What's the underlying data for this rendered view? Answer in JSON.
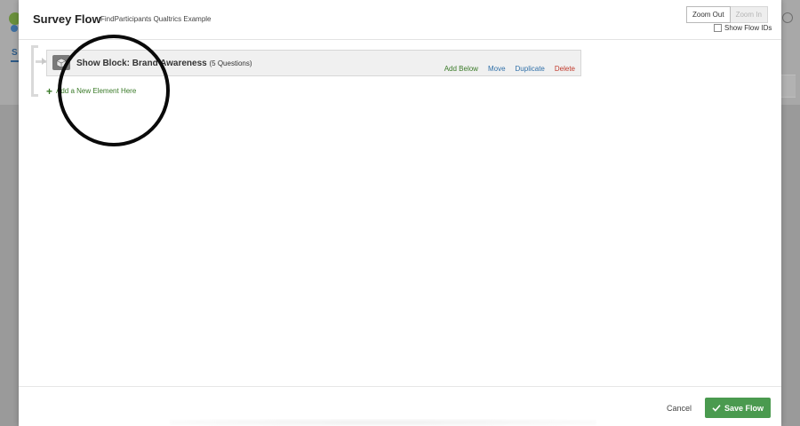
{
  "background": {
    "tab_letter": "S"
  },
  "modal": {
    "title": "Survey Flow",
    "subtitle": "FindParticipants Qualtrics Example",
    "zoom_out_label": "Zoom Out",
    "zoom_in_label": "Zoom In",
    "show_flow_ids_label": "Show Flow IDs",
    "show_flow_ids_checked": false
  },
  "flow": {
    "block": {
      "icon": "block-cube-icon",
      "title": "Show Block: Brand Awareness",
      "count": "(5 Questions)",
      "actions": {
        "add_below": "Add Below",
        "move": "Move",
        "duplicate": "Duplicate",
        "delete": "Delete"
      }
    },
    "add_element_label": "Add a New Element Here"
  },
  "footer": {
    "cancel_label": "Cancel",
    "save_label": "Save Flow"
  },
  "colors": {
    "green_accent": "#3a7a28",
    "blue_link": "#2f6fa8",
    "delete_red": "#c0392b",
    "save_button": "#4a9a4f"
  }
}
